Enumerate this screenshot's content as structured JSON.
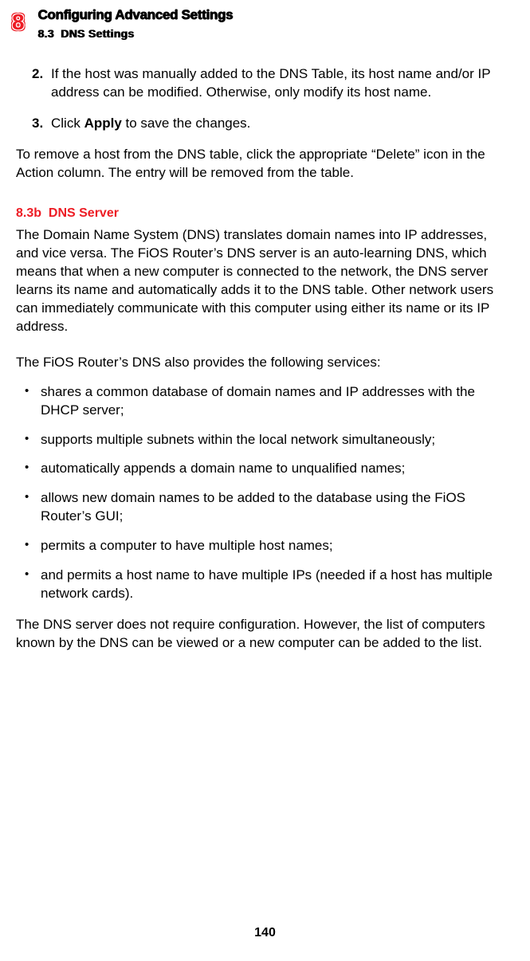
{
  "header": {
    "chapter_number": "8",
    "chapter_title": "Configuring Advanced Settings",
    "section_number": "8.3",
    "section_title": "DNS Settings"
  },
  "steps": [
    {
      "number": "2.",
      "text": "If the host was manually added to the DNS Table, its host name and/or IP address can be modified. Otherwise, only modify its host name."
    },
    {
      "number": "3.",
      "prefix": "Click ",
      "bold": "Apply",
      "suffix": " to save the changes."
    }
  ],
  "remove_para": "To remove a host from the DNS table, click the appropriate “Delete” icon in the Action column. The entry will be removed from the table.",
  "sub": {
    "number": "8.3b",
    "title": "DNS Server"
  },
  "dns_intro": "The Domain Name System (DNS) translates domain names into IP addresses, and vice versa. The FiOS Router’s DNS server is an auto-learning DNS, which means that when a new computer is connected to the network, the DNS server learns its name and automatically adds it to the DNS table. Other network users can immediately communicate with this computer using either its name or its IP address.",
  "dns_services_intro": "The FiOS Router’s DNS also provides the following services:",
  "bullets": [
    "shares a common database of domain names and IP addresses with the DHCP server;",
    "supports multiple subnets within the local network simultaneously;",
    "automatically appends a domain name to unqualified names;",
    "allows new domain names to be added to the database using the FiOS Router’s GUI;",
    "permits a computer to have multiple host names;",
    "and permits a host name to have multiple IPs (needed if a host has multiple network cards)."
  ],
  "dns_outro": "The DNS server does not require configuration. However, the list of computers known by the DNS can be viewed or a new computer can be added to the list.",
  "page_number": "140",
  "bullet_glyph": "•"
}
